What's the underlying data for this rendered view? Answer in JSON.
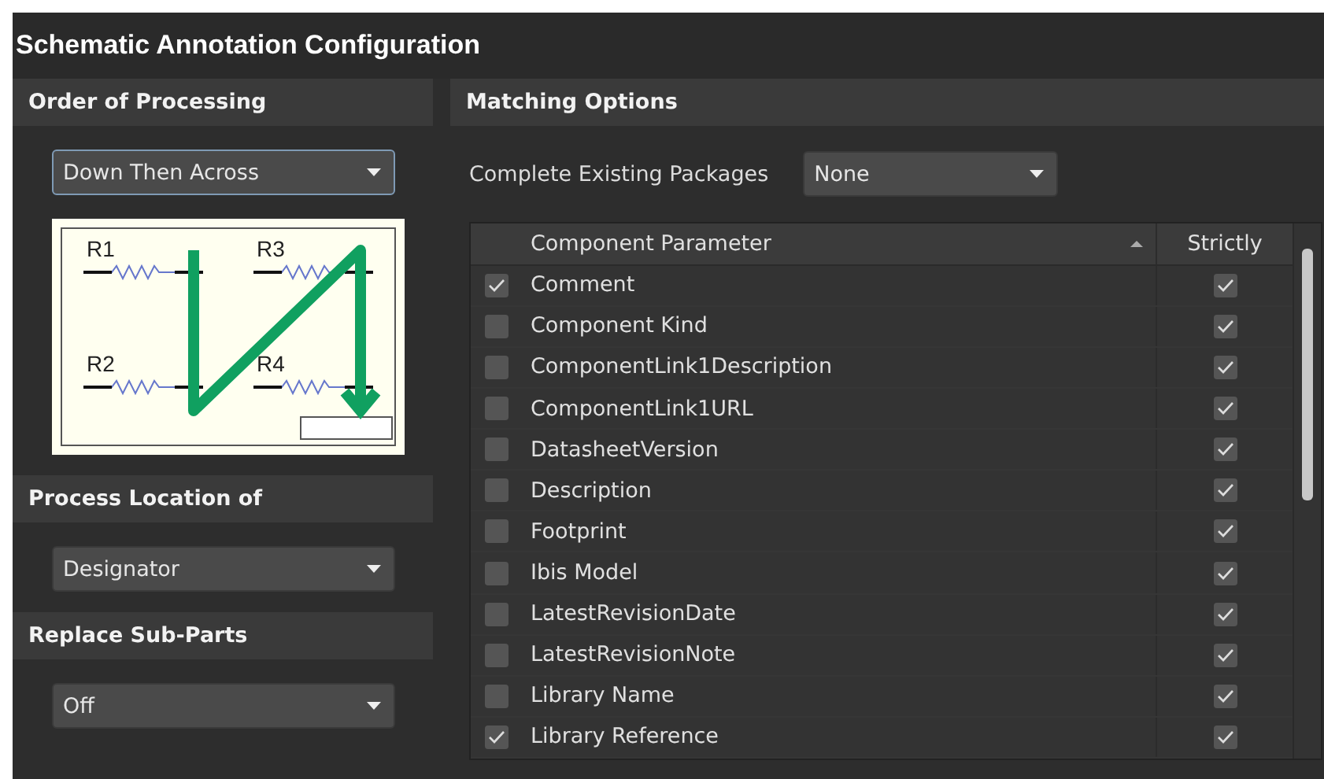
{
  "title": "Schematic Annotation Configuration",
  "left": {
    "sections": [
      {
        "kind": "dropdown-with-diagram",
        "heading": "Order of Processing",
        "value": "Down Then Across",
        "focused": true,
        "diagram": {
          "labels": [
            "R1",
            "R2",
            "R3",
            "R4"
          ]
        }
      },
      {
        "kind": "dropdown",
        "heading": "Process Location of",
        "value": "Designator",
        "focused": false
      },
      {
        "kind": "dropdown",
        "heading": "Replace Sub-Parts",
        "value": "Off",
        "focused": false
      }
    ]
  },
  "matching": {
    "heading": "Matching Options",
    "packages_label": "Complete Existing Packages",
    "packages_value": "None",
    "table": {
      "columns": [
        "Component Parameter",
        "Strictly"
      ],
      "rows": [
        {
          "name": "Comment",
          "checked": true,
          "strictly": true
        },
        {
          "name": "Component Kind",
          "checked": false,
          "strictly": true
        },
        {
          "name": "ComponentLink1Description",
          "checked": false,
          "strictly": true
        },
        {
          "name": "ComponentLink1URL",
          "checked": false,
          "strictly": true
        },
        {
          "name": "DatasheetVersion",
          "checked": false,
          "strictly": true
        },
        {
          "name": "Description",
          "checked": false,
          "strictly": true
        },
        {
          "name": "Footprint",
          "checked": false,
          "strictly": true
        },
        {
          "name": "Ibis Model",
          "checked": false,
          "strictly": true
        },
        {
          "name": "LatestRevisionDate",
          "checked": false,
          "strictly": true
        },
        {
          "name": "LatestRevisionNote",
          "checked": false,
          "strictly": true
        },
        {
          "name": "Library Name",
          "checked": false,
          "strictly": true
        },
        {
          "name": "Library Reference",
          "checked": true,
          "strictly": true
        }
      ]
    }
  }
}
